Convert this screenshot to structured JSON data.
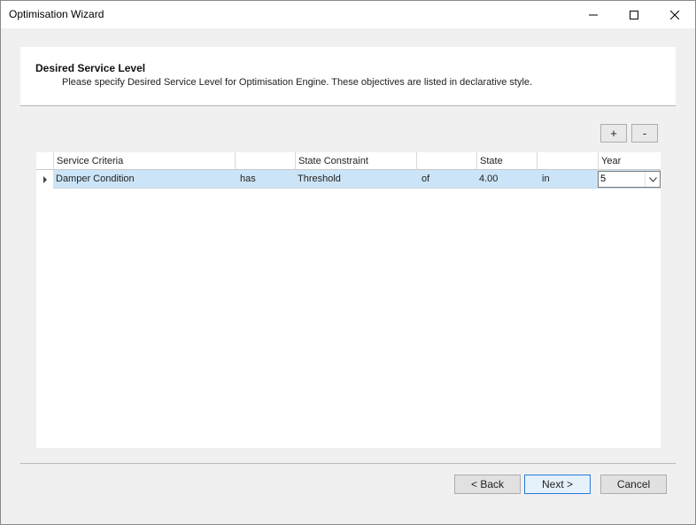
{
  "window": {
    "title": "Optimisation Wizard"
  },
  "header": {
    "title": "Desired Service Level",
    "description": "Please specify Desired Service Level for Optimisation Engine. These objectives are listed in declarative style."
  },
  "grid_buttons": {
    "add_label": "+",
    "remove_label": "-"
  },
  "grid": {
    "columns": [
      "Service Criteria",
      "",
      "State Constraint",
      "",
      "State",
      "",
      "Year"
    ],
    "rows": [
      {
        "criteria": "Damper Condition",
        "verb": "has",
        "constraint": "Threshold",
        "of": "of",
        "state": "4.00",
        "in": "in",
        "year": "5"
      }
    ]
  },
  "footer": {
    "back_label": "< Back",
    "next_label": "Next >",
    "cancel_label": "Cancel"
  },
  "icons": {
    "minimize": "minimize-icon",
    "maximize": "maximize-icon",
    "close": "close-icon",
    "row_pointer": "row-pointer-icon",
    "dropdown": "chevron-down-icon"
  }
}
